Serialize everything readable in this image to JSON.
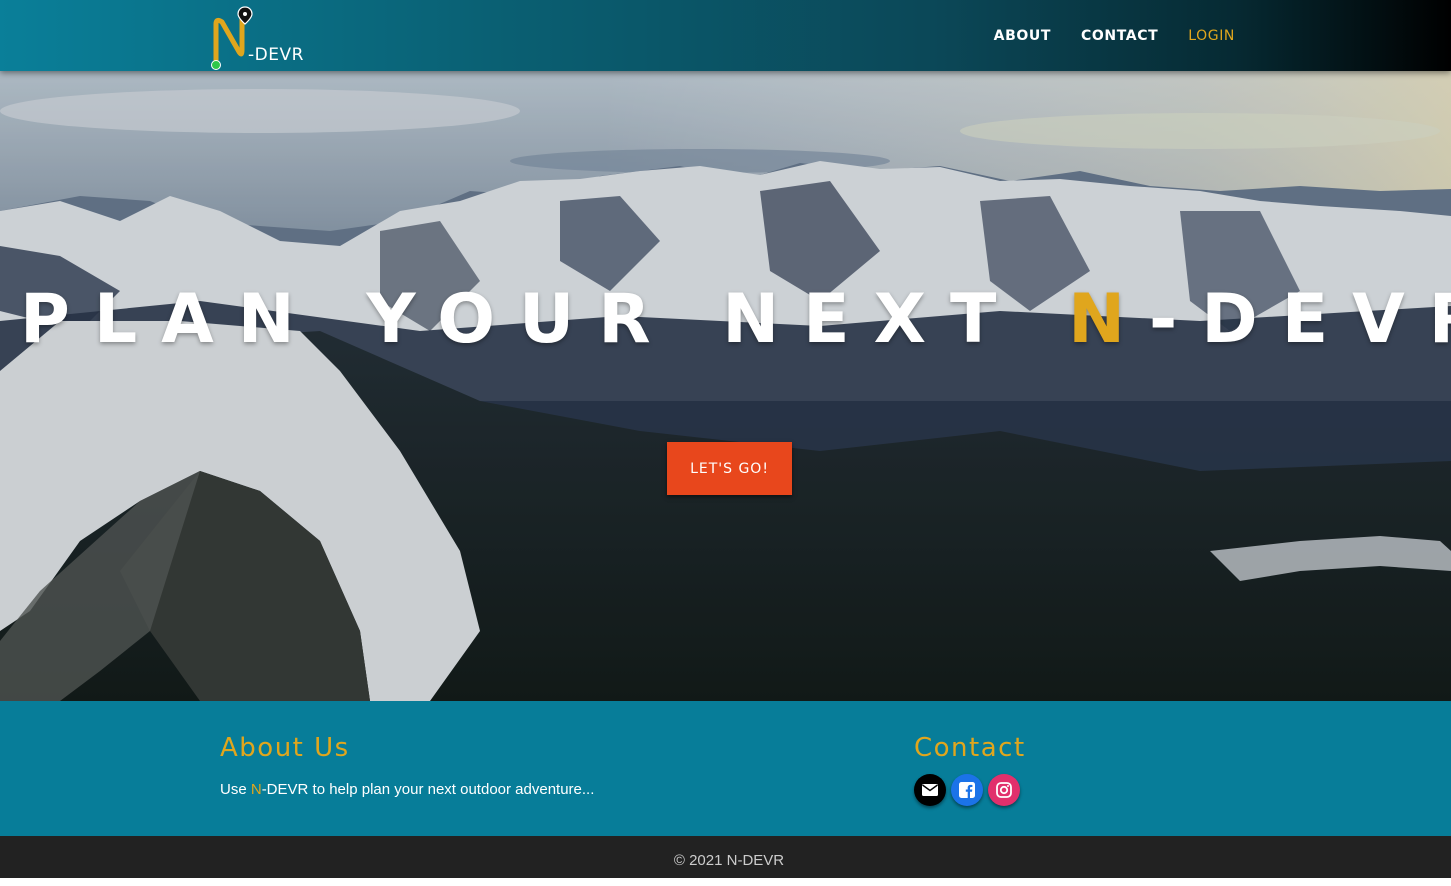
{
  "brand": {
    "letter": "N",
    "suffix": "-DEVR",
    "accent_color": "#e0a61d"
  },
  "nav": {
    "items": [
      {
        "label": "ABOUT"
      },
      {
        "label": "CONTACT"
      },
      {
        "label": "LOGIN"
      }
    ]
  },
  "hero": {
    "title_pre": "PLAN YOUR NEXT ",
    "title_accent": "N",
    "title_post": "-DEVR",
    "cta_label": "LET'S GO!",
    "cta_color": "#e8471c"
  },
  "about": {
    "title": "About Us",
    "text_pre": "Use ",
    "text_accent": "N",
    "text_post": "-DEVR to help plan your next outdoor adventure..."
  },
  "contact": {
    "title": "Contact",
    "icons": [
      {
        "name": "envelope-icon",
        "color": "#000000"
      },
      {
        "name": "facebook-icon",
        "color": "#1b73e8"
      },
      {
        "name": "instagram-icon",
        "color": "#e1306c"
      }
    ]
  },
  "footer": {
    "copyright": "© 2021 N-DEVR"
  },
  "colors": {
    "primary": "#077d99",
    "accent": "#e0a61d",
    "footer_bg": "#222222"
  }
}
